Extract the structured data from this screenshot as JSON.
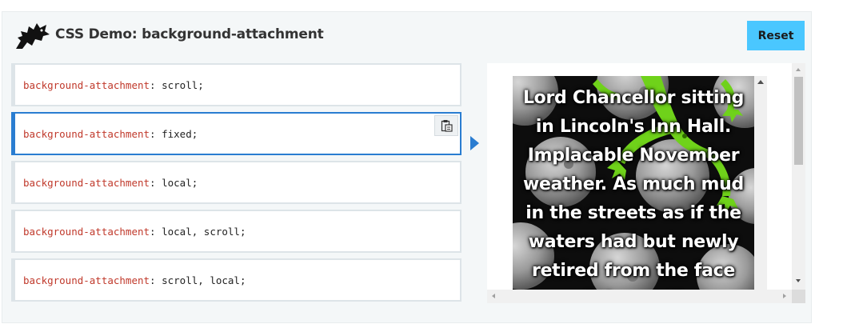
{
  "header": {
    "title": "CSS Demo: background-attachment",
    "reset_label": "Reset",
    "logo_icon": "dinosaur-logo-icon"
  },
  "options": [
    {
      "prop": "background-attachment",
      "value": "scroll;"
    },
    {
      "prop": "background-attachment",
      "value": "fixed;",
      "selected": true
    },
    {
      "prop": "background-attachment",
      "value": "local;"
    },
    {
      "prop": "background-attachment",
      "value": "local, scroll;"
    },
    {
      "prop": "background-attachment",
      "value": "scroll, local;"
    }
  ],
  "copy_icon": "clipboard-icon",
  "output": {
    "text": "Lord Chancellor sitting in Lincoln's Inn Hall. Implacable November weather. As much mud in the streets as if the waters had but newly retired from the face of the earth."
  },
  "colors": {
    "accent": "#2a7dd1",
    "reset_bg": "#4ac7ff",
    "property": "#c0392b",
    "lizard": "#6fd21a"
  }
}
